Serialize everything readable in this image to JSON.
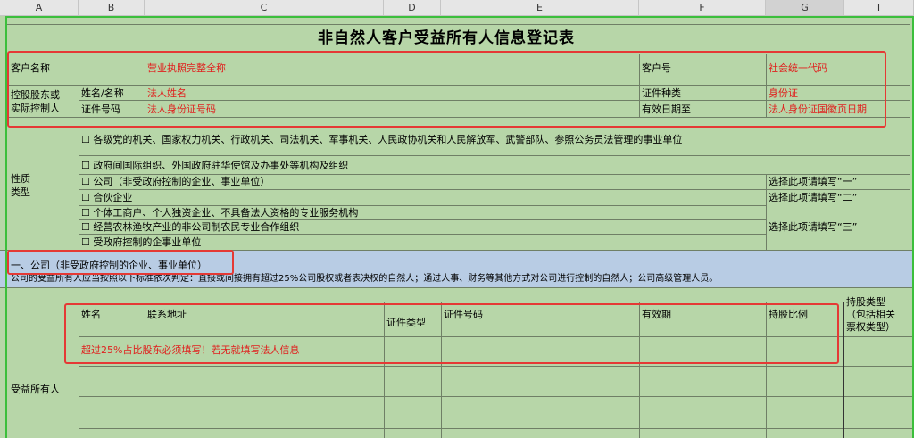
{
  "columns": [
    "A",
    "B",
    "C",
    "D",
    "E",
    "F",
    "G",
    "I"
  ],
  "title": "非自然人客户受益所有人信息登记表",
  "customer": {
    "name_label": "客户名称",
    "name_value": "营业执照完整全称",
    "no_label": "客户号",
    "no_value": "社会统一代码"
  },
  "controller": {
    "label_line1": "控股股东或",
    "label_line2": "实际控制人",
    "name_label": "姓名/名称",
    "name_value": "法人姓名",
    "idtype_label": "证件种类",
    "idtype_value": "身份证",
    "idno_label": "证件号码",
    "idno_value": "法人身份证号码",
    "valid_label": "有效日期至",
    "valid_value": "法人身份证国徽页日期"
  },
  "nature": {
    "label_line1": "性质",
    "label_line2": "类型",
    "options": [
      "☐ 各级党的机关、国家权力机关、行政机关、司法机关、军事机关、人民政协机关和人民解放军、武警部队、参照公务员法管理的事业单位",
      "☐ 政府间国际组织、外国政府驻华使馆及办事处等机构及组织",
      "☐ 公司（非受政府控制的企业、事业单位）",
      "☐ 合伙企业",
      "☐ 个体工商户、个人独资企业、不具备法人资格的专业服务机构",
      "☐ 经营农林渔牧产业的非公司制农民专业合作组织",
      "☐ 受政府控制的企事业单位"
    ],
    "hint1": "选择此项请填写“一”",
    "hint2": "选择此项请填写“二”",
    "hint3": "选择此项请填写“三”"
  },
  "section1": {
    "heading": "一、公司（非受政府控制的企业、事业单位）",
    "description": "公司的受益所有人应当按照以下标准依次判定：直接或间接拥有超过25%公司股权或者表决权的自然人；通过人事、财务等其他方式对公司进行控制的自然人；公司高级管理人员。"
  },
  "beneficiary": {
    "row_label": "受益所有人",
    "headers": {
      "name": "姓名",
      "address": "联系地址",
      "idtype": "证件类型",
      "idno": "证件号码",
      "valid": "有效期",
      "ratio": "持股比例",
      "holdtype_line1": "持股类型",
      "holdtype_line2": "（包括相关",
      "holdtype_line3": "票权类型）"
    },
    "note": "超过25%占比股东必须填写！若无就填写法人信息"
  }
}
